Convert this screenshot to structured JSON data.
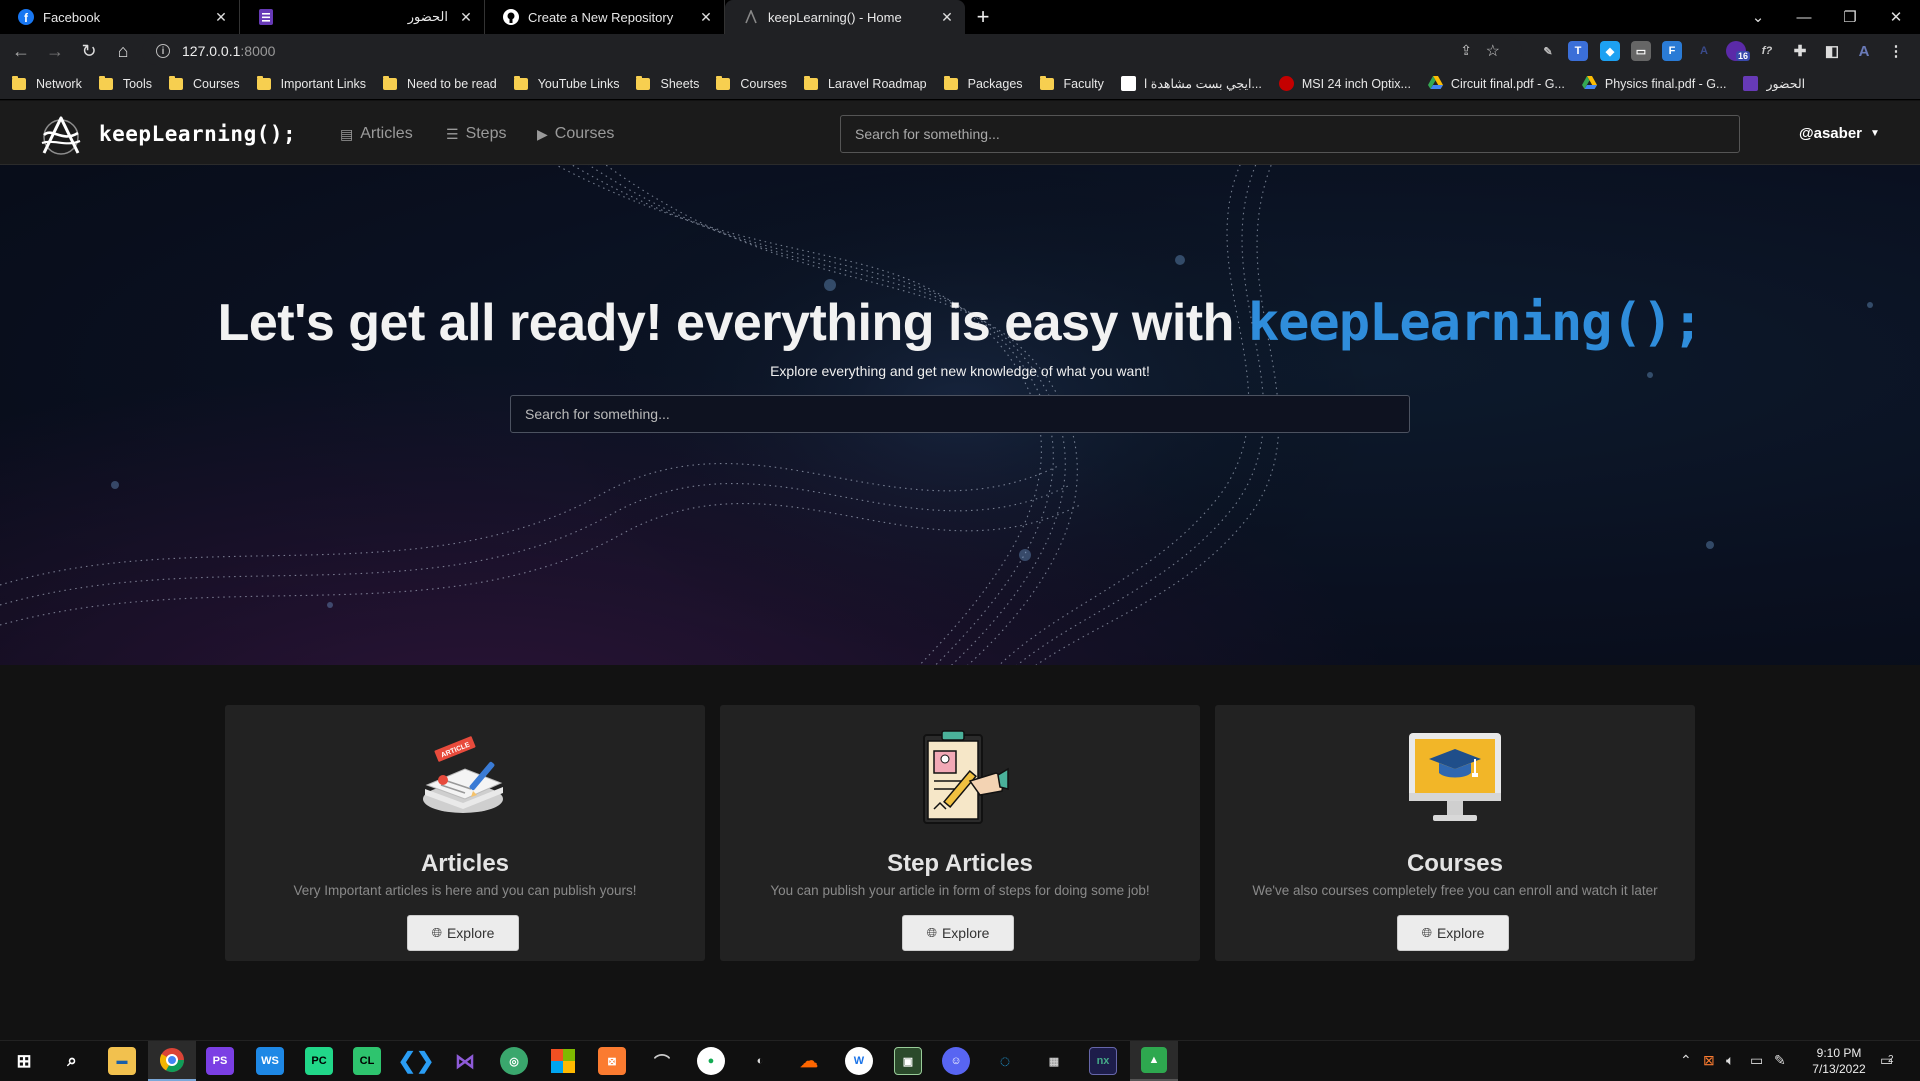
{
  "browser": {
    "tabs": [
      {
        "title": "Facebook",
        "icon": "facebook-icon",
        "color": "#1877f2",
        "active": false
      },
      {
        "title": "الحضور",
        "icon": "forms-icon",
        "color": "#673ab7",
        "active": false
      },
      {
        "title": "Create a New Repository",
        "icon": "github-icon",
        "color": "#ffffff",
        "active": false
      },
      {
        "title": "keepLearning() - Home",
        "icon": "keeplearning-icon",
        "color": "#888888",
        "active": true
      }
    ],
    "url_host": "127.0.0.1",
    "url_port": ":8000",
    "bookmarks": [
      {
        "label": "Network",
        "type": "folder"
      },
      {
        "label": "Tools",
        "type": "folder"
      },
      {
        "label": "Courses",
        "type": "folder"
      },
      {
        "label": "Important Links",
        "type": "folder"
      },
      {
        "label": "Need to be read",
        "type": "folder"
      },
      {
        "label": "YouTube Links",
        "type": "folder"
      },
      {
        "label": "Sheets",
        "type": "folder"
      },
      {
        "label": "Courses",
        "type": "folder"
      },
      {
        "label": "Laravel Roadmap",
        "type": "folder"
      },
      {
        "label": "Packages",
        "type": "folder"
      },
      {
        "label": "Faculty",
        "type": "folder"
      },
      {
        "label": "ايجي بست مشاهدة ا...",
        "type": "page"
      },
      {
        "label": "MSI 24 inch Optix...",
        "type": "page"
      },
      {
        "label": "Circuit final.pdf - G...",
        "type": "drive"
      },
      {
        "label": "Physics final.pdf - G...",
        "type": "drive"
      },
      {
        "label": "الحضور",
        "type": "forms"
      }
    ],
    "extension_badge": "16"
  },
  "site": {
    "brand": "keepLearning();",
    "nav": [
      {
        "label": "Articles",
        "icon": "newspaper-icon"
      },
      {
        "label": "Steps",
        "icon": "list-icon"
      },
      {
        "label": "Courses",
        "icon": "play-icon"
      }
    ],
    "search_placeholder": "Search for something...",
    "user": "@asaber"
  },
  "hero": {
    "title_prefix": "Let's get all ready! everything is easy with ",
    "title_brand": "keepLearning();",
    "subtitle": "Explore everything and get new knowledge of what you want!",
    "search_placeholder": "Search for something..."
  },
  "cards": [
    {
      "title": "Articles",
      "description": "Very Important articles is here and you can publish yours!",
      "button": "Explore",
      "icon": "article-icon"
    },
    {
      "title": "Step Articles",
      "description": "You can publish your article in form of steps for doing some job!",
      "button": "Explore",
      "icon": "step-article-icon"
    },
    {
      "title": "Courses",
      "description": "We've also courses completely free you can enroll and watch it later",
      "button": "Explore",
      "icon": "course-monitor-icon"
    }
  ],
  "taskbar": {
    "time": "9:10 PM",
    "date": "7/13/2022",
    "notification_count": "2"
  }
}
